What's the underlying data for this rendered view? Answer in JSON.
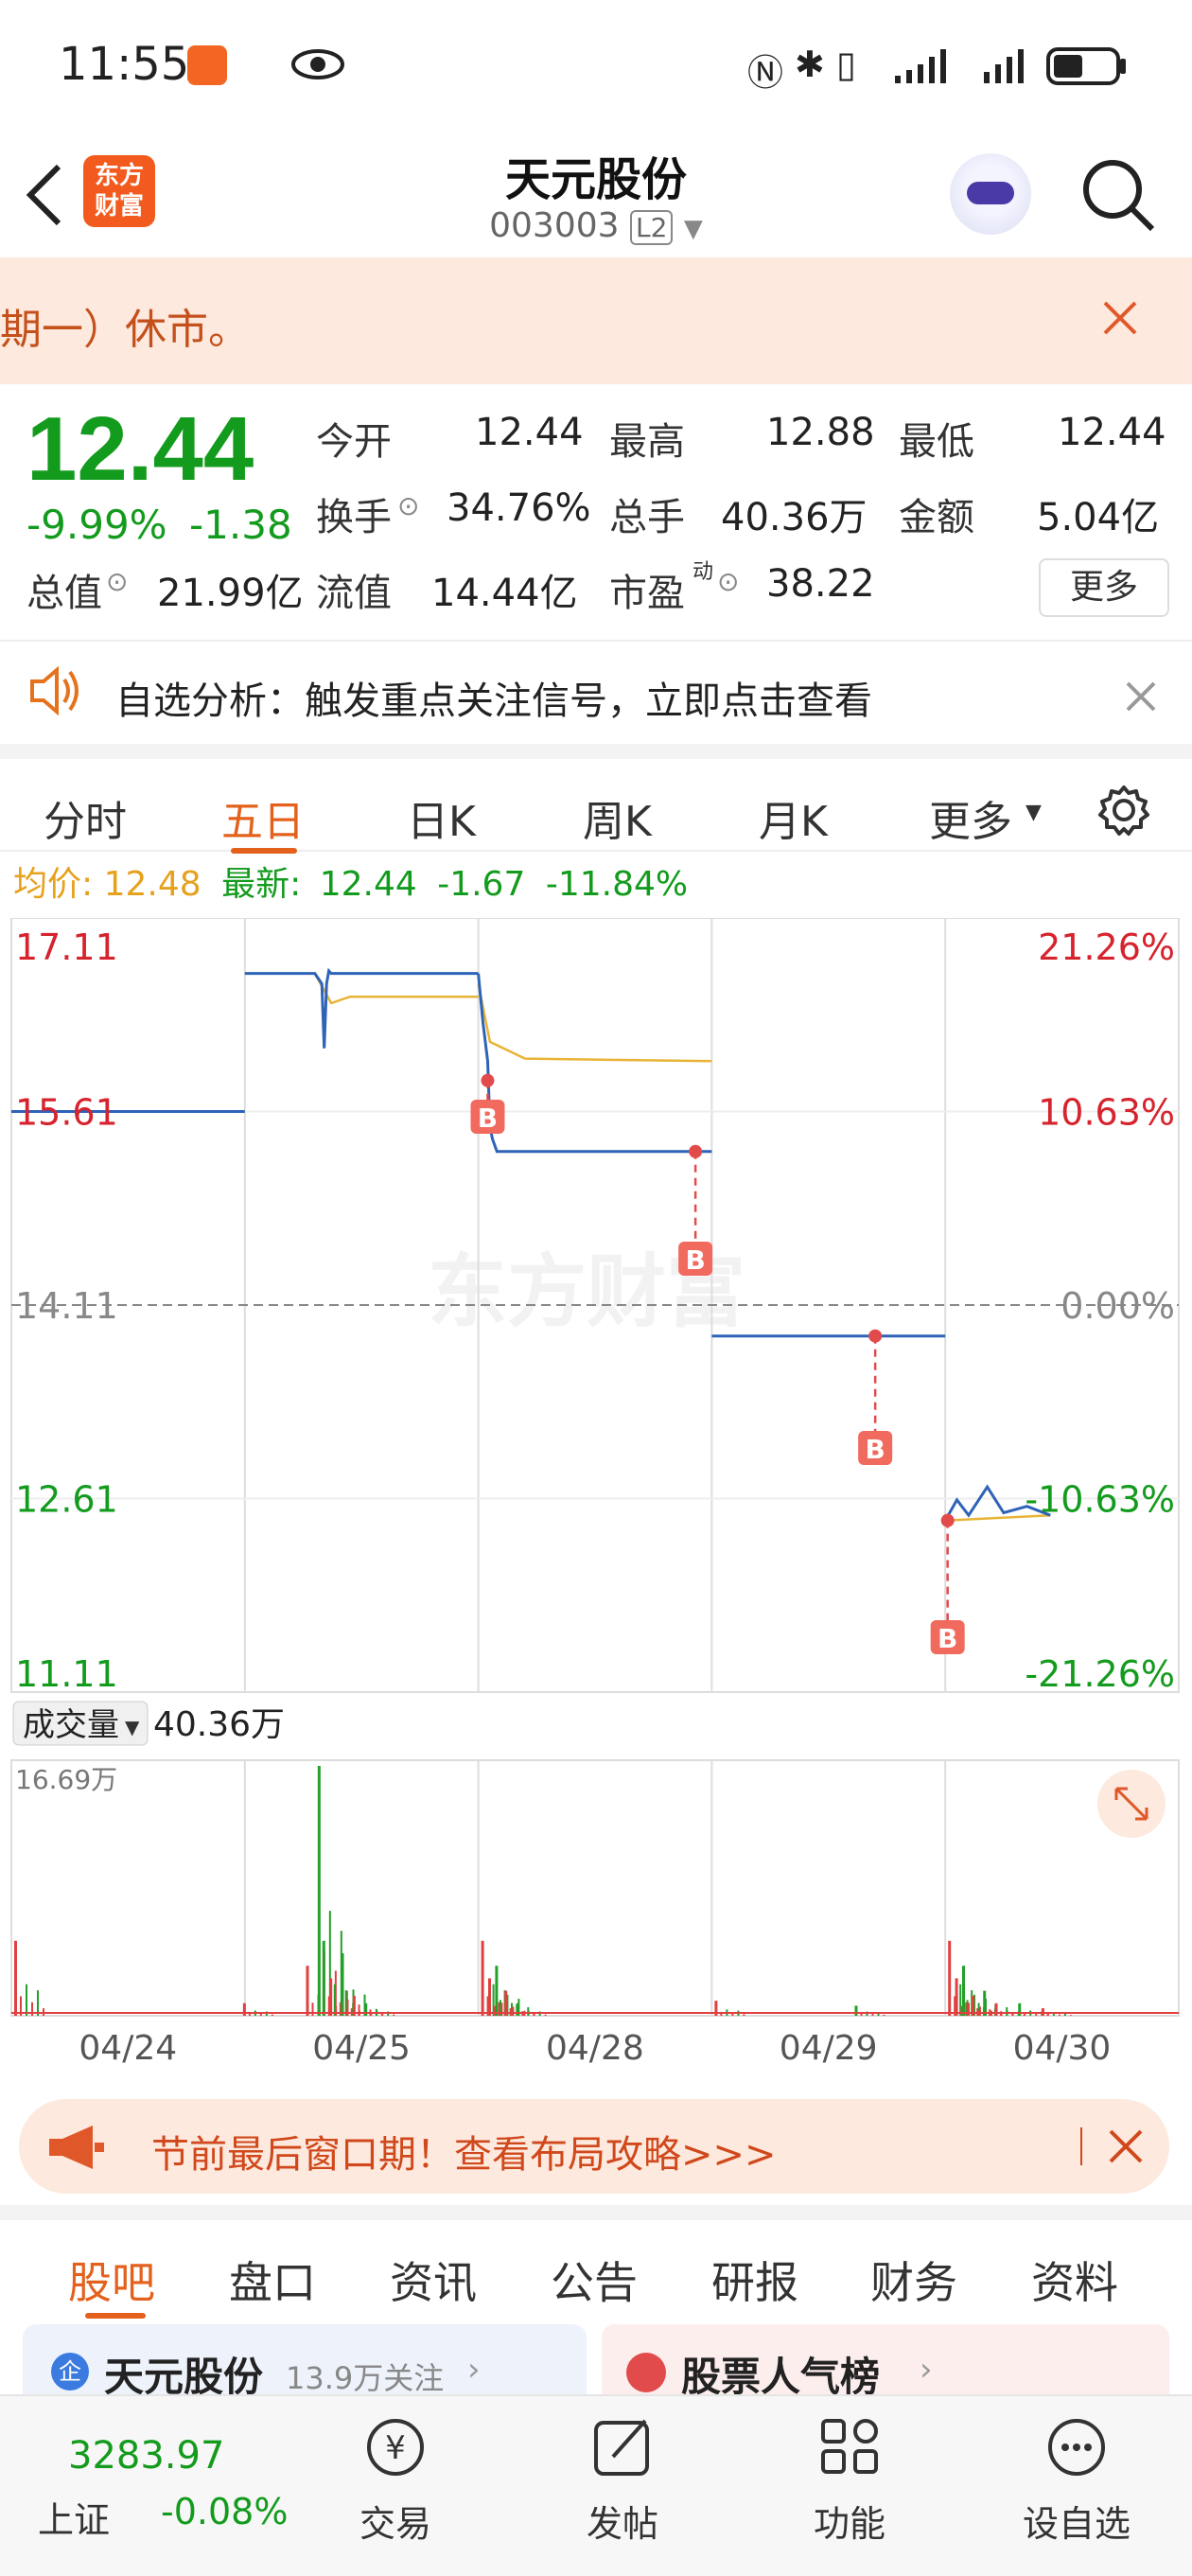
{
  "status_bar": {
    "time": "11:55"
  },
  "header": {
    "back_label": "",
    "logo_text_1": "东方",
    "logo_text_2": "财富",
    "title": "天元股份",
    "code": "003003",
    "level_badge": "L2"
  },
  "banner": {
    "text": "期一）休市。"
  },
  "quote": {
    "price": "12.44",
    "change_pct": "-9.99%",
    "change": "-1.38",
    "open_label": "今开",
    "open": "12.44",
    "high_label": "最高",
    "high": "12.88",
    "low_label": "最低",
    "low": "12.44",
    "turnover_label": "换手",
    "turnover": "34.76%",
    "volume_label": "总手",
    "volume": "40.36万",
    "amount_label": "金额",
    "amount": "5.04亿",
    "mktcap_label": "总值",
    "mktcap": "21.99亿",
    "float_label": "流值",
    "float": "14.44亿",
    "pe_label": "市盈",
    "pe_sup": "动",
    "pe": "38.22",
    "more_button": "更多"
  },
  "alert": {
    "text": "自选分析：触发重点关注信号，立即点击查看"
  },
  "chart_tabs": [
    "分时",
    "五日",
    "日K",
    "周K",
    "月K",
    "更多"
  ],
  "active_tab": "五日",
  "info_bar": {
    "avg_label": "均价:",
    "avg": "12.48",
    "latest_label": "最新:",
    "latest": "12.44",
    "change": "-1.67",
    "change_pct": "-11.84%"
  },
  "chart_data": {
    "type": "line",
    "x_labels": [
      "04/24",
      "04/25",
      "04/28",
      "04/29",
      "04/30"
    ],
    "y_left_ticks": [
      "17.11",
      "15.61",
      "14.11",
      "12.61",
      "11.11"
    ],
    "y_right_ticks": [
      "21.26%",
      "10.63%",
      "0.00%",
      "-10.63%",
      "-21.26%"
    ],
    "ylim": [
      11.11,
      17.11
    ],
    "prev_close": 14.11,
    "watermark": "东方财富",
    "series": [
      {
        "day": "04/24",
        "price": [
          [
            0,
            15.61
          ],
          [
            1,
            15.61
          ]
        ]
      },
      {
        "day": "04/25",
        "price": [
          [
            0,
            16.68
          ],
          [
            0.3,
            16.68
          ],
          [
            0.33,
            16.6
          ],
          [
            0.34,
            16.1
          ],
          [
            0.35,
            16.6
          ],
          [
            0.36,
            16.7
          ],
          [
            0.37,
            16.68
          ],
          [
            1,
            16.68
          ]
        ],
        "avg": [
          [
            0.3,
            16.68
          ],
          [
            0.37,
            16.45
          ],
          [
            0.45,
            16.5
          ],
          [
            1,
            16.5
          ]
        ]
      },
      {
        "day": "04/28",
        "price": [
          [
            0,
            16.68
          ],
          [
            0.02,
            16.3
          ],
          [
            0.04,
            16.0
          ],
          [
            0.05,
            15.5
          ],
          [
            0.06,
            15.4
          ],
          [
            0.08,
            15.3
          ],
          [
            1,
            15.3
          ]
        ],
        "avg": [
          [
            0,
            16.6
          ],
          [
            0.05,
            16.15
          ],
          [
            0.2,
            16.02
          ],
          [
            1,
            16.0
          ]
        ]
      },
      {
        "day": "04/29",
        "price": [
          [
            0,
            13.87
          ],
          [
            1,
            13.87
          ]
        ]
      },
      {
        "day": "04/30",
        "price": [
          [
            0,
            12.44
          ],
          [
            0.05,
            12.6
          ],
          [
            0.1,
            12.48
          ],
          [
            0.18,
            12.7
          ],
          [
            0.25,
            12.5
          ],
          [
            0.35,
            12.55
          ],
          [
            0.45,
            12.48
          ]
        ],
        "avg": [
          [
            0,
            12.44
          ],
          [
            0.45,
            12.48
          ]
        ]
      }
    ],
    "buy_markers": [
      "B",
      "B",
      "B",
      "B"
    ],
    "volume": {
      "label": "成交量",
      "total": "40.36万",
      "max_label": "16.69万"
    }
  },
  "promo": {
    "text": "节前最后窗口期！查看布局攻略>>>"
  },
  "sub_tabs": [
    "股吧",
    "盘口",
    "资讯",
    "公告",
    "研报",
    "财务",
    "资料"
  ],
  "active_sub_tab": "股吧",
  "cards": {
    "stock_name": "天元股份",
    "followers": "13.9万关注",
    "rank_title": "股票人气榜"
  },
  "bottom_bar": {
    "index_value": "3283.97",
    "index_name": "上证",
    "index_change": "-0.08%",
    "items": [
      "交易",
      "发帖",
      "功能",
      "设自选"
    ]
  }
}
